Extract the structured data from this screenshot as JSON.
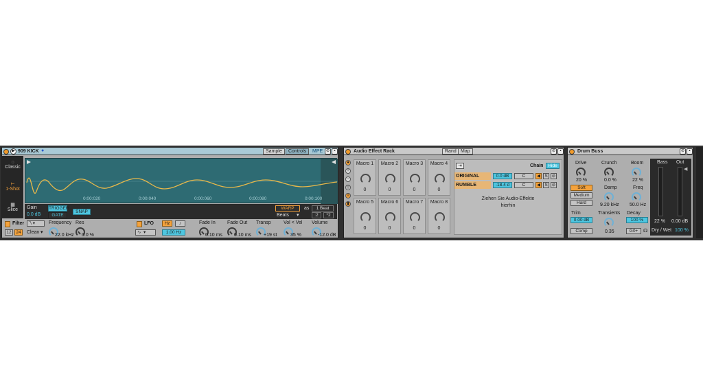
{
  "simpler": {
    "title": "909 KICK",
    "tabs": [
      "Sample",
      "Controls"
    ],
    "mpe": "MPE",
    "modes": [
      "Classic",
      "1-Shot",
      "Slice"
    ],
    "ruler": [
      "0:00:020",
      "0:00:040",
      "0:00:060",
      "0:00:080",
      "0:00:100"
    ],
    "gain_label": "Gain",
    "gain_value": "0.0 dB",
    "trigger": "TRIGGER",
    "gate": "GATE",
    "snap": "SNAP",
    "warp": "WARP",
    "as": "as",
    "beat": "1 Beat",
    "beats": "Beats",
    "div": ":2",
    "mul": "*2",
    "filter_label": "Filter",
    "filter_12": "12",
    "filter_24": "24",
    "clean": "Clean",
    "frequency_label": "Frequency",
    "frequency_value": "22.0 kHz",
    "res_label": "Res",
    "res_value": "0.0 %",
    "lfo_label": "LFO",
    "lfo_hz": "Hz",
    "lfo_note": "♪",
    "lfo_rate": "1.00 Hz",
    "fadein_label": "Fade In",
    "fadein_value": "0.10 ms",
    "fadeout_label": "Fade Out",
    "fadeout_value": "0.10 ms",
    "transp_label": "Transp",
    "transp_value": "+19 st",
    "volvel_label": "Vol < Vel",
    "volvel_value": "35 %",
    "volume_label": "Volume",
    "volume_value": "-12.0 dB"
  },
  "rack": {
    "title": "Audio Effect Rack",
    "rand": "Rand",
    "map": "Map",
    "macros": [
      {
        "name": "Macro 1",
        "value": "0"
      },
      {
        "name": "Macro 2",
        "value": "0"
      },
      {
        "name": "Macro 3",
        "value": "0"
      },
      {
        "name": "Macro 4",
        "value": "0"
      },
      {
        "name": "Macro 5",
        "value": "0"
      },
      {
        "name": "Macro 6",
        "value": "0"
      },
      {
        "name": "Macro 7",
        "value": "0"
      },
      {
        "name": "Macro 8",
        "value": "0"
      }
    ],
    "chain_label": "Chain",
    "hide": "Hide",
    "chains": [
      {
        "name": "ORIGINAL",
        "vol": "0.0 dB",
        "pan": "C",
        "s": "S"
      },
      {
        "name": "RUMBLE",
        "vol": "-18.4 d",
        "pan": "C",
        "s": "S"
      }
    ],
    "drop_hint_1": "Ziehen Sie Audio-Effekte",
    "drop_hint_2": "hierhin"
  },
  "drumbuss": {
    "title": "Drum Buss",
    "drive_label": "Drive",
    "drive_value": "20 %",
    "soft": "Soft",
    "medium": "Medium",
    "hard": "Hard",
    "trim_label": "Trim",
    "trim_value": "0.00 dB",
    "comp": "Comp",
    "crunch_label": "Crunch",
    "crunch_value": "0.0 %",
    "damp_label": "Damp",
    "damp_value": "9.20 kHz",
    "transients_label": "Transients",
    "transients_value": "0.35",
    "boom_label": "Boom",
    "boom_value": "22 %",
    "freq_label": "Freq",
    "freq_value": "50.0 Hz",
    "decay_label": "Decay",
    "decay_value": "100 %",
    "go": "G0+",
    "bass_label": "Bass",
    "out_label": "Out",
    "bass_value": "22 %",
    "out_value": "0.00 dB",
    "drywet_label": "Dry / Wet",
    "drywet_value": "100 %"
  },
  "colors": {
    "accent": "#f4a23c",
    "cyan": "#4ec6e0",
    "waveform_bg": "#2e6b73",
    "waveform_line": "#e8b84a"
  }
}
